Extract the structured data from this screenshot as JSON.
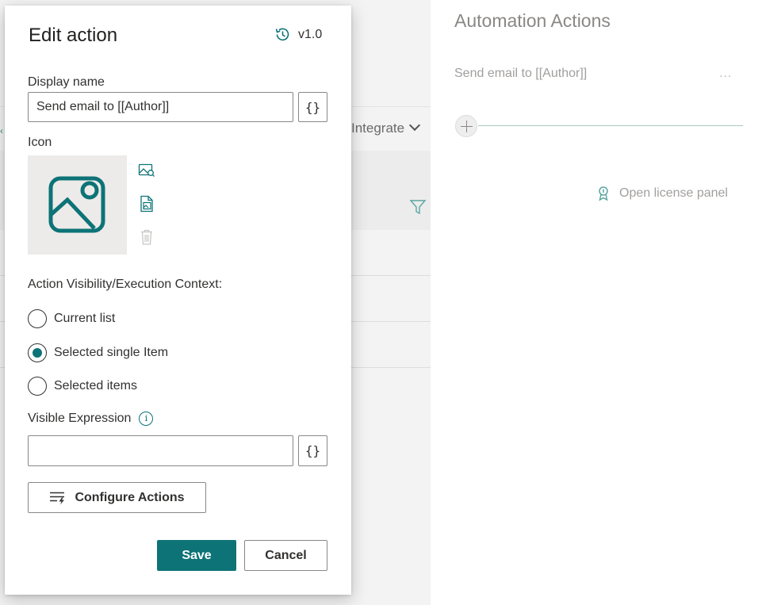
{
  "background": {
    "integrate_label": "Integrate"
  },
  "automation_panel": {
    "title": "Automation Actions",
    "actions": [
      {
        "label": "Send email to [[Author]]",
        "more": "..."
      }
    ],
    "license_link": "Open license panel"
  },
  "dialog": {
    "title": "Edit action",
    "version": "v1.0",
    "display_name_label": "Display name",
    "display_name_value": "Send email to [[Author]]",
    "brace_label": "{}",
    "icon_label": "Icon",
    "visibility_label": "Action Visibility/Execution Context:",
    "visibility_options": [
      {
        "label": "Current list",
        "checked": false
      },
      {
        "label": "Selected single Item",
        "checked": true
      },
      {
        "label": "Selected items",
        "checked": false
      }
    ],
    "visible_expression_label": "Visible Expression",
    "visible_expression_value": "",
    "info_glyph": "i",
    "configure_label": "Configure Actions",
    "save_label": "Save",
    "cancel_label": "Cancel"
  },
  "colors": {
    "accent": "#0d7377",
    "panel_text": "#8a8886"
  }
}
